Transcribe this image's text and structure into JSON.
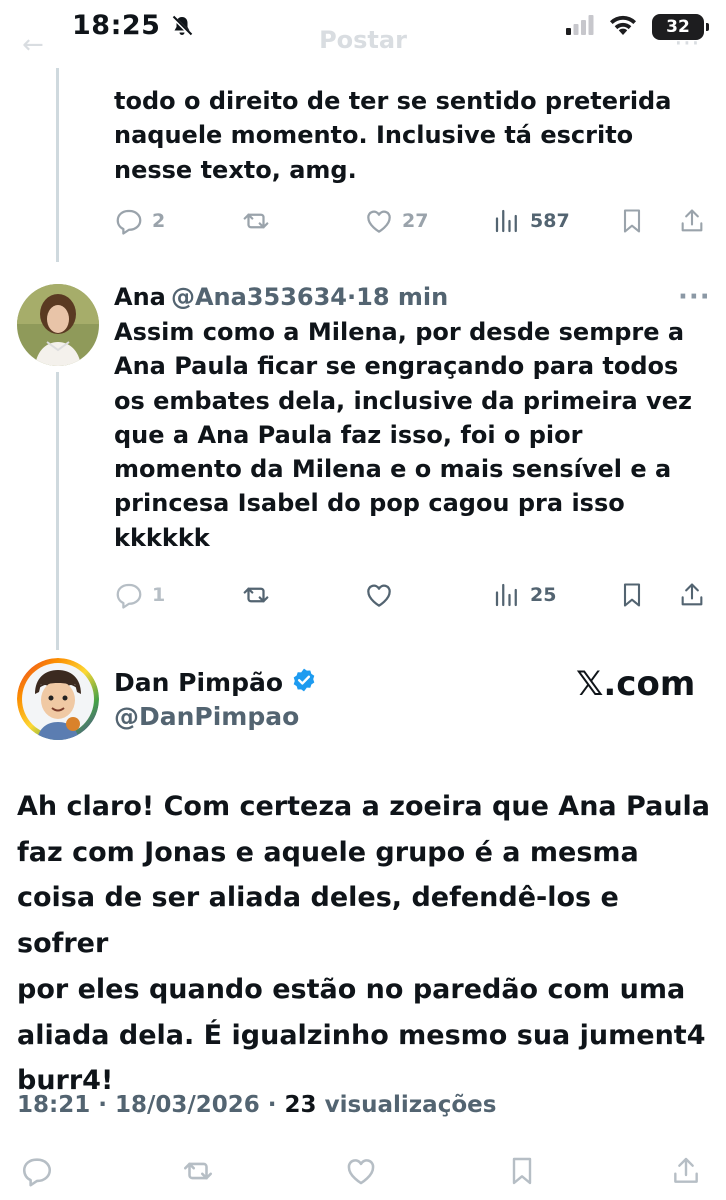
{
  "status_bar": {
    "time": "18:25",
    "battery": "32"
  },
  "header": {
    "title": "Postar"
  },
  "tweet1": {
    "text_lines": [
      "todo o direito de ter se sentido preterida",
      "naquele momento. Inclusive tá escrito",
      "nesse texto, amg."
    ],
    "replies": "2",
    "reposts": "",
    "likes": "27",
    "views": "587"
  },
  "tweet2": {
    "name": "Ana",
    "handle": "@Ana353634",
    "separator": "·",
    "time": "18 min",
    "more": "···",
    "text_lines": [
      "Assim como a Milena, por desde sempre a",
      "Ana Paula ficar se engraçando para todos",
      "os embates dela, inclusive da primeira vez",
      "que a Ana Paula faz isso, foi o pior",
      "momento da Milena e o mais sensível e a",
      "princesa Isabel do pop cagou pra isso",
      "kkkkkk"
    ],
    "replies": "1",
    "views": "25"
  },
  "main_tweet": {
    "name": "Dan Pimpão",
    "handle": "@DanPimpao",
    "source": "𝕏.com",
    "text_lines": [
      "Ah claro! Com certeza a zoeira que Ana Paula",
      "faz com Jonas e aquele grupo é a mesma",
      "coisa de ser aliada deles, defendê-los e sofrer",
      "por eles quando estão no paredão com uma",
      "aliada dela. É igualzinho mesmo sua jument4",
      "burr4!"
    ],
    "timestamp": "18:21 · 18/03/2026 · ",
    "views_count": "23",
    "views_label": " visualizações"
  },
  "colors": {
    "text": "#0f1419",
    "secondary": "#536471",
    "faded": "#9aa3ab",
    "verified": "#1d9bf0",
    "thread": "#cfd9de"
  }
}
